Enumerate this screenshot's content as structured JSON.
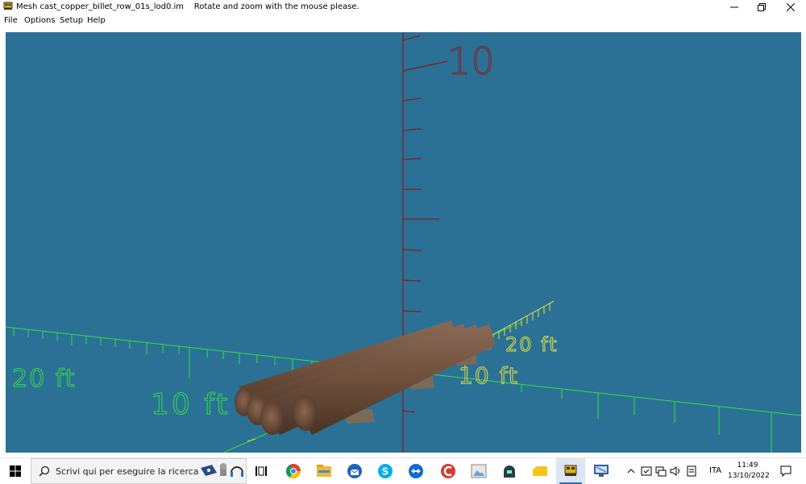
{
  "window": {
    "title": "Mesh cast_copper_billet_row_01s_lod0.im    Rotate and zoom with the mouse please.",
    "icon": "train-app-icon"
  },
  "menu": {
    "items": [
      {
        "label": "File"
      },
      {
        "label": "Options"
      },
      {
        "label": "Setup"
      },
      {
        "label": "Help"
      }
    ]
  },
  "viewport": {
    "background": "#2b7195",
    "labels": {
      "vertical_scale": "10",
      "right_axis_near": "10 ft",
      "right_axis_far": "20 ft",
      "left_axis_near": "10 ft",
      "left_axis_far": "20 ft"
    },
    "colors": {
      "vertical_axis": "#8b1a1a",
      "ground_grid": "#33dd44",
      "depth_axis": "#dddd44",
      "billet": "#7a5a45",
      "support": "#7a6a5a"
    }
  },
  "taskbar": {
    "search_placeholder": "Scrivi qui per eseguire la ricerca",
    "apps": [
      {
        "name": "cortana-widget-icon"
      },
      {
        "name": "task-view-icon"
      },
      {
        "name": "chrome-icon"
      },
      {
        "name": "file-explorer-icon"
      },
      {
        "name": "thunderbird-icon"
      },
      {
        "name": "skype-icon"
      },
      {
        "name": "teamviewer-icon"
      },
      {
        "name": "ccleaner-icon"
      },
      {
        "name": "image-viewer-icon"
      },
      {
        "name": "game-launcher-icon"
      },
      {
        "name": "folder-yellow-icon"
      },
      {
        "name": "train-app-icon"
      },
      {
        "name": "remote-desktop-icon"
      }
    ],
    "tray": {
      "language": "ITA",
      "time": "11:49",
      "date": "13/10/2022"
    }
  }
}
